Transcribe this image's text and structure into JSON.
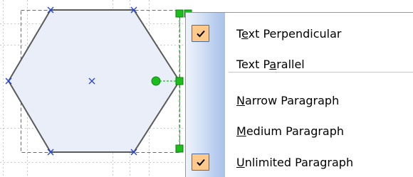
{
  "menu": {
    "items": [
      {
        "pre": "T",
        "key": "e",
        "post": "xt Perpendicular",
        "checked": true
      },
      {
        "pre": "Text P",
        "key": "a",
        "post": "rallel",
        "checked": false
      },
      {
        "pre": "",
        "key": "N",
        "post": "arrow Paragraph",
        "checked": false
      },
      {
        "pre": "",
        "key": "M",
        "post": "edium Paragraph",
        "checked": false
      },
      {
        "pre": "",
        "key": "U",
        "post": "nlimited Paragraph",
        "checked": true
      }
    ]
  },
  "colors": {
    "shape_fill": "#e9eef8",
    "shape_stroke": "#5a5a5a",
    "connection_x": "#1f3fd6",
    "handle_green": "#1dbd1d",
    "check_bg": "#ffc98b",
    "check_border": "#4b6aa0"
  },
  "icons": [
    "checkmark-icon",
    "connection-point-icon",
    "selection-handle-icon",
    "rotation-handle-icon"
  ]
}
